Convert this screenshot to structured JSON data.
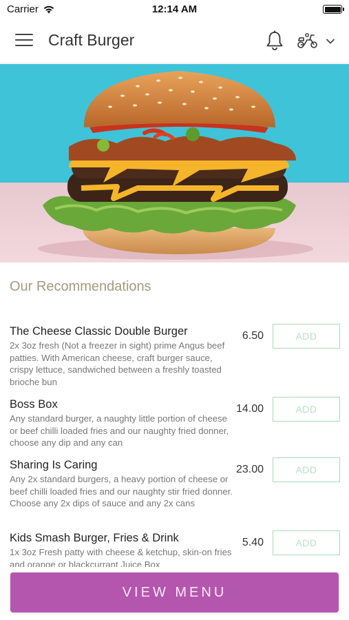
{
  "status_bar": {
    "carrier": "Carrier",
    "time": "12:14 AM",
    "wifi_icon": "wifi-icon",
    "battery_icon": "battery-full-icon"
  },
  "header": {
    "title": "Craft Burger",
    "menu_icon": "hamburger-menu-icon",
    "bell_icon": "bell-icon",
    "delivery_icon": "scooter-icon",
    "dropdown_icon": "chevron-down-icon"
  },
  "hero": {
    "image": "burger-photo",
    "background_color": "#3ec3d9"
  },
  "section_title": "Our Recommendations",
  "items": [
    {
      "name": "The Cheese Classic Double Burger",
      "description": "2x 3oz fresh (Not a freezer in sight) prime Angus beef patties. With American cheese, craft burger sauce, crispy lettuce, sandwiched between a freshly toasted brioche bun",
      "price": "6.50",
      "add_label": "ADD"
    },
    {
      "name": "Boss Box",
      "description": "Any standard burger, a naughty little portion of cheese or beef chilli loaded fries and our naughty fried donner, choose any dip and any can",
      "price": "14.00",
      "add_label": "ADD"
    },
    {
      "name": "Sharing Is Caring",
      "description": "Any 2x standard burgers, a heavy portion of cheese or beef chilli loaded fries and our naughty stir fried donner. Choose any 2x dips of sauce and any 2x cans",
      "price": "23.00",
      "add_label": "ADD"
    },
    {
      "name": "Kids Smash Burger, Fries & Drink",
      "description": "1x 3oz Fresh patty with cheese & ketchup, skin-on fries and orange or blackcurrant Juice Box",
      "price": "5.40",
      "add_label": "ADD"
    }
  ],
  "view_menu_label": "VIEW MENU",
  "colors": {
    "accent": "#b456ad",
    "section_title": "#a59a7d",
    "add_border": "#a8d9bd"
  }
}
